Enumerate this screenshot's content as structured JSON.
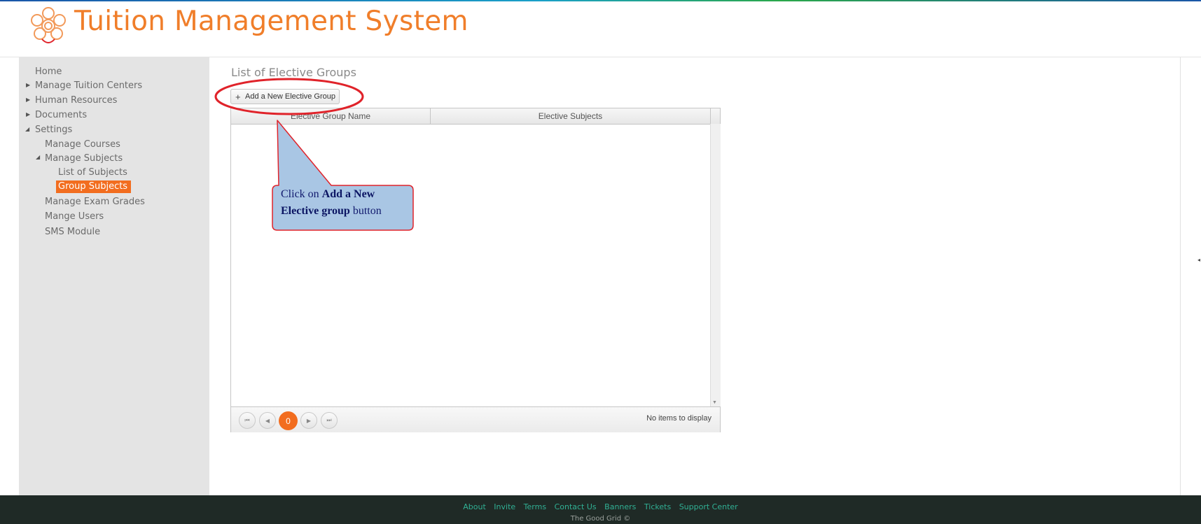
{
  "app": {
    "title": "Tuition Management System"
  },
  "sidebar": {
    "items": [
      {
        "label": "Home"
      },
      {
        "label": "Manage Tuition Centers"
      },
      {
        "label": "Human Resources"
      },
      {
        "label": "Documents"
      },
      {
        "label": "Settings"
      },
      {
        "label": "Manage Courses"
      },
      {
        "label": "Manage Subjects"
      },
      {
        "label": "List of Subjects"
      },
      {
        "label": "Group Subjects"
      },
      {
        "label": "Manage Exam Grades"
      },
      {
        "label": "Mange Users"
      },
      {
        "label": "SMS Module"
      }
    ]
  },
  "main": {
    "title": "List of Elective Groups",
    "add_button": "Add a New Elective Group",
    "grid": {
      "columns": [
        "Elective Group Name",
        "Elective Subjects"
      ],
      "rows": [],
      "current_page": "0",
      "pager_info": "No items to display"
    }
  },
  "callout": {
    "prefix": "Click on ",
    "bold": "Add a New Elective group",
    "suffix": " button"
  },
  "footer": {
    "links": [
      "About",
      "Invite",
      "Terms",
      "Contact Us",
      "Banners",
      "Tickets",
      "Support Center"
    ],
    "copyright": "The Good Grid ©"
  },
  "colors": {
    "accent": "#f26d1f",
    "title": "#f07e2a",
    "footer_bg": "#1f2a26",
    "footer_link": "#30b094",
    "callout_fill": "#a9c6e4",
    "callout_border": "#e0232a"
  }
}
